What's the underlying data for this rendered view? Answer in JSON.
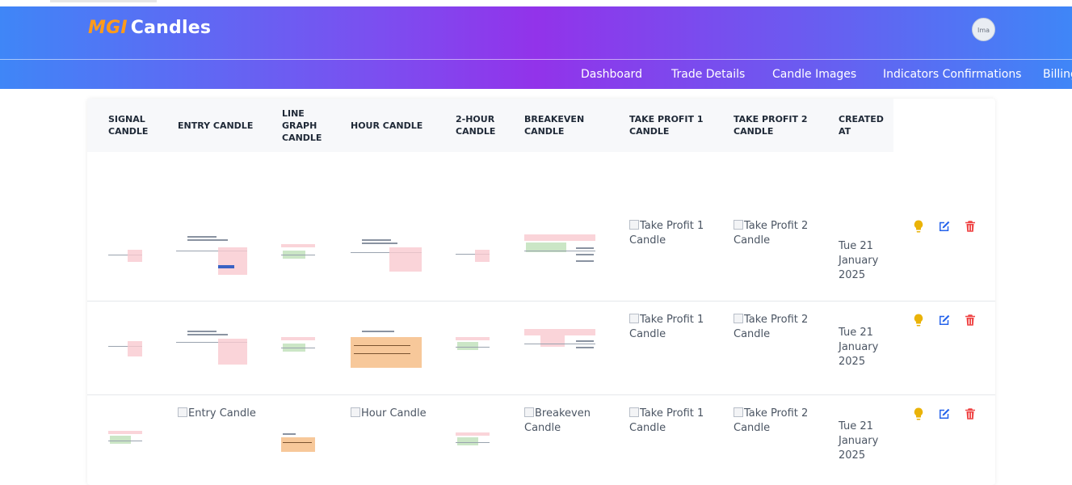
{
  "brand": {
    "part1": "MGI",
    "part2": "Candles"
  },
  "avatar": {
    "alt": "Ima"
  },
  "nav": [
    "Dashboard",
    "Trade Details",
    "Candle Images",
    "Indicators Confirmations",
    "Billing"
  ],
  "table": {
    "headers": [
      [
        "SIGNAL",
        "CANDLE"
      ],
      [
        "ENTRY CANDLE"
      ],
      [
        "LINE",
        "GRAPH",
        "CANDLE"
      ],
      [
        "HOUR CANDLE"
      ],
      [
        "2-HOUR",
        "CANDLE"
      ],
      [
        "BREAKEVEN",
        "CANDLE"
      ],
      [
        "TAKE PROFIT 1",
        "CANDLE"
      ],
      [
        "TAKE PROFIT 2",
        "CANDLE"
      ],
      [
        "CREATED",
        "AT"
      ]
    ],
    "rows": [
      {
        "tp1_alt": [
          "Take Profit 1",
          "Candle"
        ],
        "tp2_alt": [
          "Take Profit 2",
          "Candle"
        ],
        "date": [
          "Tue 21",
          "January",
          "2025"
        ]
      },
      {
        "tp1_alt": [
          "Take Profit 1",
          "Candle"
        ],
        "tp2_alt": [
          "Take Profit 2",
          "Candle"
        ],
        "date": [
          "Tue 21",
          "January",
          "2025"
        ]
      },
      {
        "entry_alt": [
          "Entry Candle"
        ],
        "hour_alt": [
          "Hour Candle"
        ],
        "breakeven_alt": [
          "Breakeven",
          "Candle"
        ],
        "tp1_alt": [
          "Take Profit 1",
          "Candle"
        ],
        "tp2_alt": [
          "Take Profit 2",
          "Candle"
        ],
        "date": [
          "Tue 21",
          "January",
          "2025"
        ]
      }
    ]
  },
  "actions": {
    "bulb_icon": "lightbulb-icon",
    "edit_icon": "edit-icon",
    "delete_icon": "trash-icon"
  },
  "colors": {
    "brand_accent": "#ff9b1a",
    "bulb": "#eab308",
    "edit": "#2563eb",
    "delete": "#ef4444"
  }
}
